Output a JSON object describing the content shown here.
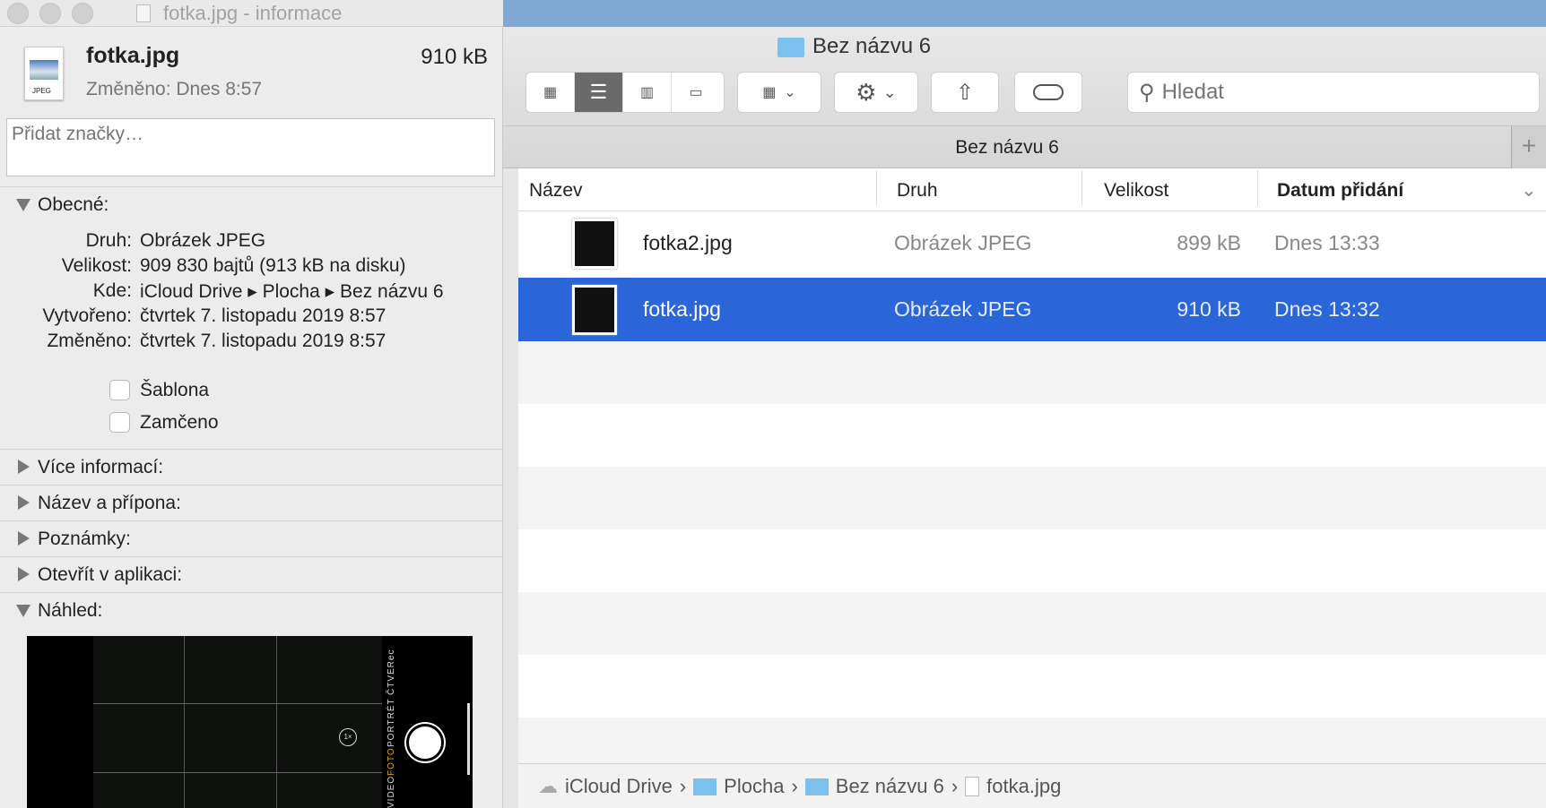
{
  "info": {
    "window_title": "fotka.jpg - informace",
    "file_name": "fotka.jpg",
    "file_size": "910 kB",
    "modified": "Změněno: Dnes 8:57",
    "icon_label": "JPEG",
    "tags_placeholder": "Přidat značky…",
    "general": {
      "title": "Obecné:",
      "rows": [
        {
          "k": "Druh:",
          "v": "Obrázek JPEG"
        },
        {
          "k": "Velikost:",
          "v": "909 830 bajtů (913 kB na disku)"
        },
        {
          "k": "Kde:",
          "v": "iCloud Drive ▸ Plocha ▸ Bez názvu 6"
        },
        {
          "k": "Vytvořeno:",
          "v": "čtvrtek 7. listopadu 2019 8:57"
        },
        {
          "k": "Změněno:",
          "v": "čtvrtek 7. listopadu 2019 8:57"
        }
      ],
      "stationery": "Šablona",
      "locked": "Zamčeno"
    },
    "sections": [
      "Více informací:",
      "Název a přípona:",
      "Poznámky:",
      "Otevřít v aplikaci:",
      "Náhled:"
    ],
    "preview": {
      "modes": [
        "ČTVERec",
        "PORTRÉT",
        "FOTO",
        "VIDEO"
      ],
      "zoom": "1×"
    }
  },
  "finder": {
    "title": "Bez názvu 6",
    "tab": "Bez názvu 6",
    "search_placeholder": "Hledat",
    "columns": [
      "Název",
      "Druh",
      "Velikost",
      "Datum přidání"
    ],
    "files": [
      {
        "name": "fotka2.jpg",
        "kind": "Obrázek JPEG",
        "size": "899 kB",
        "date": "Dnes 13:33",
        "selected": false
      },
      {
        "name": "fotka.jpg",
        "kind": "Obrázek JPEG",
        "size": "910 kB",
        "date": "Dnes 13:32",
        "selected": true
      }
    ],
    "path": [
      "iCloud Drive",
      "Plocha",
      "Bez názvu 6",
      "fotka.jpg"
    ],
    "selection_color": "#2a66d9"
  }
}
